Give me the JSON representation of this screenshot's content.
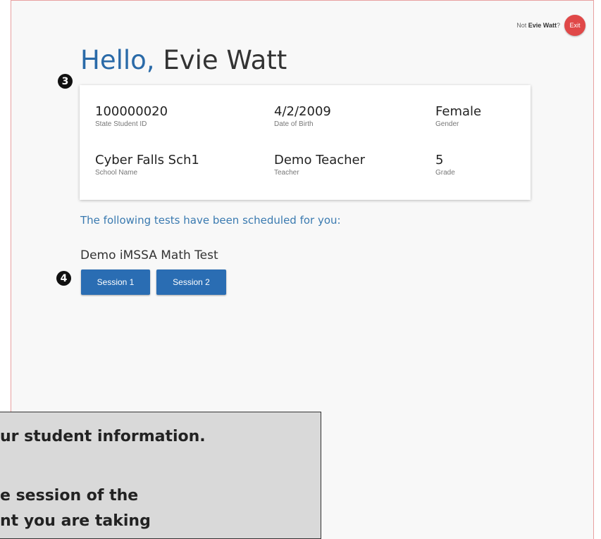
{
  "header": {
    "not_prefix": "Not ",
    "user_name": "Evie Watt",
    "not_suffix": "?",
    "exit_label": "Exit",
    "exit_color": "#e04848"
  },
  "greeting": {
    "hello": "Hello,",
    "name": "Evie Watt",
    "hello_color": "#2a6aa8"
  },
  "markers": [
    "3",
    "4"
  ],
  "student_info": {
    "state_id": {
      "value": "100000020",
      "label": "State Student ID"
    },
    "dob": {
      "value": "4/2/2009",
      "label": "Date of Birth"
    },
    "gender": {
      "value": "Female",
      "label": "Gender"
    },
    "school": {
      "value": "Cyber Falls Sch1",
      "label": "School Name"
    },
    "teacher": {
      "value": "Demo Teacher",
      "label": "Teacher"
    },
    "grade": {
      "value": "5",
      "label": "Grade"
    }
  },
  "scheduled_text": "The following tests have been scheduled for you:",
  "test": {
    "name": "Demo iMSSA Math Test",
    "sessions": [
      "Session 1",
      "Session 2"
    ],
    "button_color": "#2a6db3"
  },
  "callout": {
    "line1": "ur student information.",
    "line2": "e session of the",
    "line3": "nt you are taking"
  }
}
